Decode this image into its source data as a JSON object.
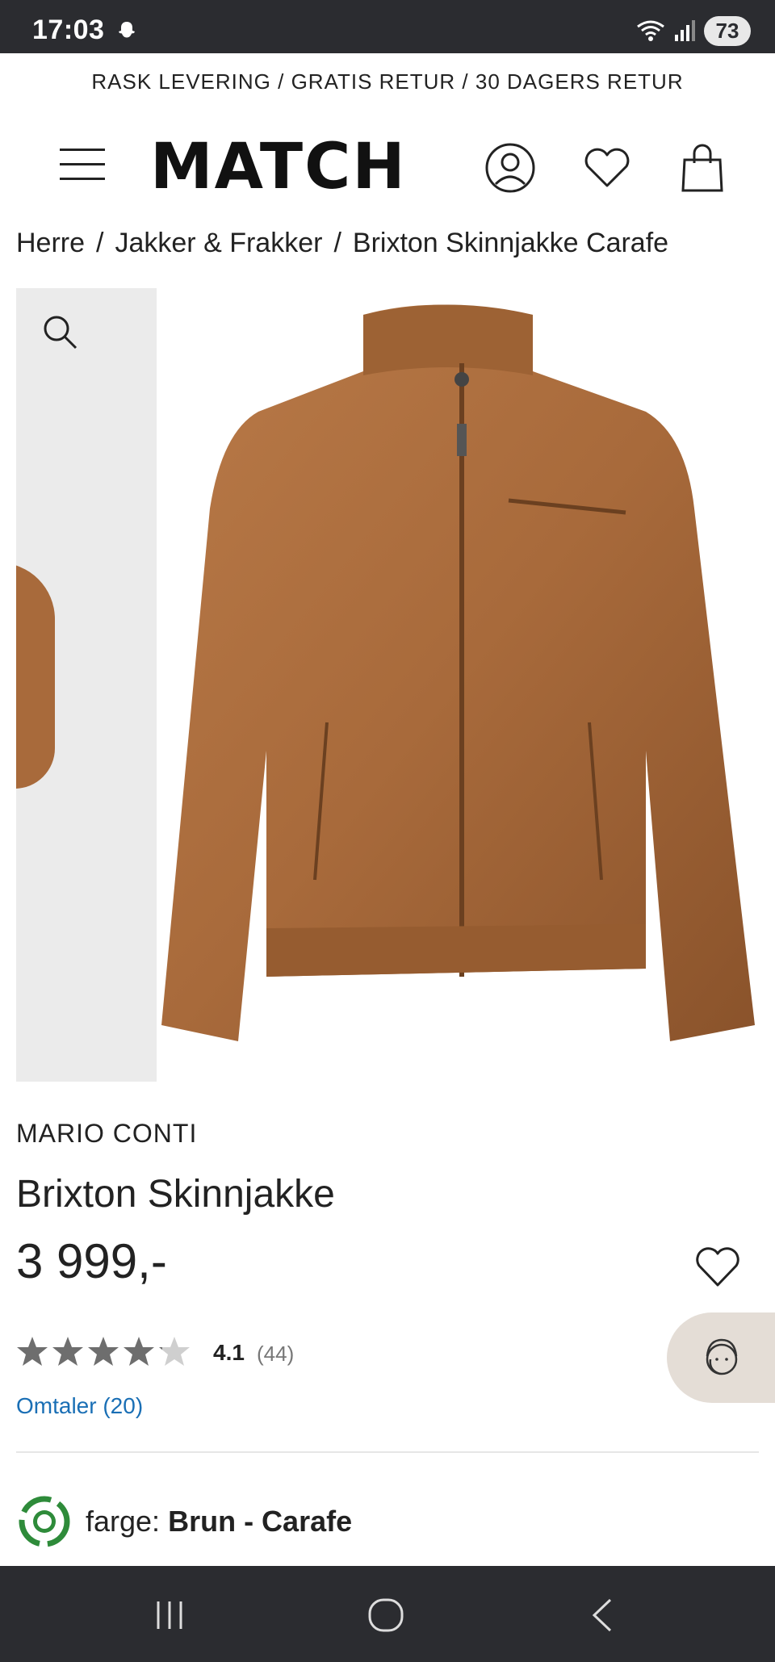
{
  "status_bar": {
    "time": "17:03",
    "battery": "73"
  },
  "promo_text": "RASK LEVERING / GRATIS RETUR / 30 DAGERS RETUR",
  "header": {
    "logo": "MATCH"
  },
  "breadcrumb": {
    "items": [
      "Herre",
      "Jakker & Frakker",
      "Brixton Skinnjakke Carafe"
    ],
    "separator": "/"
  },
  "product": {
    "brand": "MARIO CONTI",
    "name": "Brixton Skinnjakke",
    "price": "3 999,-",
    "rating_value": "4.1",
    "rating_count": "(44)",
    "rating_fraction": 0.82,
    "reviews_link": "Omtaler (20)",
    "color_label": "farge:",
    "color_value": "Brun - Carafe"
  },
  "colors": {
    "leather": "#a86a3b",
    "link": "#1a6fb5",
    "dark_bar": "#2b2c30",
    "chat_bg": "#e4ddd6",
    "star": "#6e6e6e",
    "eco_green": "#2e8b3a"
  },
  "icons": [
    "menu-icon",
    "account-icon",
    "heart-icon",
    "bag-icon",
    "search-icon",
    "chat-support-icon",
    "eco-icon",
    "recents-icon",
    "home-icon",
    "back-icon"
  ]
}
